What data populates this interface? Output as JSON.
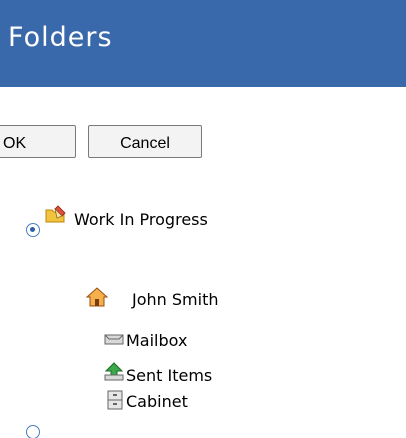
{
  "header": {
    "title": "Folders",
    "color": "#3a69ab"
  },
  "actions": {
    "ok_label": "OK",
    "cancel_label": "Cancel"
  },
  "tree": {
    "work_in_progress": {
      "label": "Work In Progress",
      "icon": "folder-edit-icon",
      "selected": true
    },
    "owner": {
      "label": "John Smith",
      "icon": "home-icon"
    },
    "children": [
      {
        "label": "Mailbox",
        "icon": "mailbox-icon"
      },
      {
        "label": "Sent Items",
        "icon": "sent-items-icon"
      },
      {
        "label": "Cabinet",
        "icon": "cabinet-icon"
      }
    ]
  }
}
